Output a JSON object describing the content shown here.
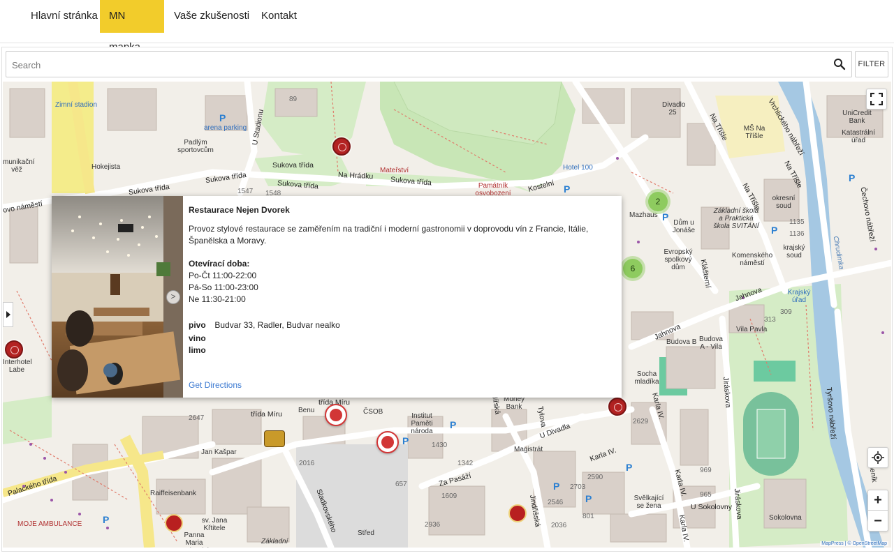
{
  "nav": {
    "items": [
      {
        "label": "Hlavní stránka",
        "active": false
      },
      {
        "label": "MN mapka",
        "active": true
      },
      {
        "label": "Vaše zkušenosti",
        "active": false
      },
      {
        "label": "Kontakt",
        "active": false
      }
    ],
    "accent_color": "#f2cc2b"
  },
  "search": {
    "placeholder": "Search",
    "value": "",
    "icon": "search-icon"
  },
  "filter_label": "FILTER",
  "map": {
    "labels": {
      "zimni_stadion": "Zimní stadion",
      "arena_parking": "arena parking",
      "padlym_sportovcum": "Padlým sportovcům",
      "hokejista": "Hokejista",
      "u_stadionu": "U Stadionu",
      "sukova_1": "Sukova třída",
      "sukova_2": "Sukova třída",
      "sukova_3": "Sukova třída",
      "sukova_4": "Sukova třída",
      "sukova_5": "Sukova třída",
      "na_hradku": "Na Hrádku",
      "materstvi": "Mateřství",
      "pamatnik": "Památník osvobození",
      "kostelni": "Kostelní",
      "hotel_100": "Hotel 100",
      "divadlo_25": "Divadlo 25",
      "ms_na_trisle": "MŠ Na Tříšle",
      "vrchlickeho": "Vrchlického nábřeží",
      "unicredit": "UniCredit Bank",
      "katastralni": "Katastrální úřad",
      "na_trisle_1": "Na Tříšle",
      "na_trisle_2": "Na Tříšle",
      "na_trisle_3": "Na Tříšle",
      "okresni_soud": "okresní soud",
      "krajsky_soud": "krajský soud",
      "cechovo": "Čechovo nábřeží",
      "chrudimka": "Chrudimka",
      "mazhaus": "Mazhaus",
      "dum_u_jonase": "Dům u Jonáše",
      "zakladni_skola": "Základní škola a Praktická škola SVITÁNÍ",
      "evropsky_dum": "Evropský spolkový dům",
      "komenskeho": "Komenského náměstí",
      "klasterni": "Klášterní",
      "jahnova_1": "Jahnova",
      "jahnova_2": "Jahnova",
      "krajsky_urad": "Krajský úřad",
      "vila_pavla": "Vila Pavla",
      "budova_b": "Budova B",
      "budova_a": "Budova A - Vila",
      "socha_mladika": "Socha mladíka",
      "jiraskova_1": "Jiráskova",
      "jiraskova_2": "Jiráskova",
      "tyrsovo": "Tyršovo nábřeží",
      "karla_iv_1": "Karla IV.",
      "karla_iv_2": "Karla IV.",
      "karla_iv_3": "Karla IV.",
      "karla_iv_4": "Karla IV.",
      "u_sokolovny": "U Sokolovny",
      "sokolovna": "Sokolovna",
      "bubenik": "Bubeník",
      "trida_miru_1": "třída Míru",
      "trida_miru_2": "třída Míru",
      "benu": "Benu",
      "csob": "ČSOB",
      "jan_kaspar": "Jan Kašpar",
      "raiffeisenbank": "Raiffeisenbank",
      "palackeho": "Palackého třída",
      "moje_ambulance": "MOJE AMBULANCE",
      "sv_jana": "sv. Jana Křtitele",
      "panna_maria": "Panna Maria Karlovská",
      "zakladni_2": "Základní",
      "sladkovskeho": "Sladkovského",
      "stred": "Střed",
      "jindrisska": "Jindřišská",
      "za_pasazi": "Za Pasáží",
      "institut": "Institut Paměti národa",
      "magistrat": "Magistrát",
      "u_divadla": "U Divadla",
      "tylova": "Tylova",
      "money_bank": "Money Bank",
      "jiriska": "Jiřská",
      "karla_iv_5": "Karla IV.",
      "interhotel": "Interhotel Labe",
      "nameste": "ovo náměstí",
      "munikacni": "munikační věž",
      "sveleji": "Svělkající se žena"
    },
    "house_numbers": [
      "89",
      "1547",
      "1548",
      "2647",
      "2016",
      "1430",
      "2629",
      "1342",
      "2703",
      "1609",
      "801",
      "2036",
      "2590",
      "309",
      "313",
      "965",
      "969",
      "2936",
      "657",
      "1135",
      "1136",
      "2546"
    ],
    "clusters": [
      {
        "count": "2"
      },
      {
        "count": "6"
      }
    ],
    "attribution": "MapPress | © OpenStreetMap"
  },
  "popup": {
    "title": "Restaurace Nejen Dvorek",
    "description": "Provoz stylové restaurace se zaměřením na tradiční i moderní gastronomii v doprovodu vín z Francie, Itálie, Španělska a Moravy.",
    "hours_title": "Otevírací doba:",
    "hours": [
      "Po-Čt 11:00-22:00",
      "Pá-So 11:00-23:00",
      "Ne 11:30-21:00"
    ],
    "beer_key": "pivo",
    "beer_value": "Budvar 33, Radler, Budvar nealko",
    "wine_key": "vino",
    "lemonade_key": "limo",
    "directions": "Get Directions",
    "next_photo": ">"
  },
  "controls": {
    "zoom_in": "+",
    "zoom_out": "−"
  }
}
